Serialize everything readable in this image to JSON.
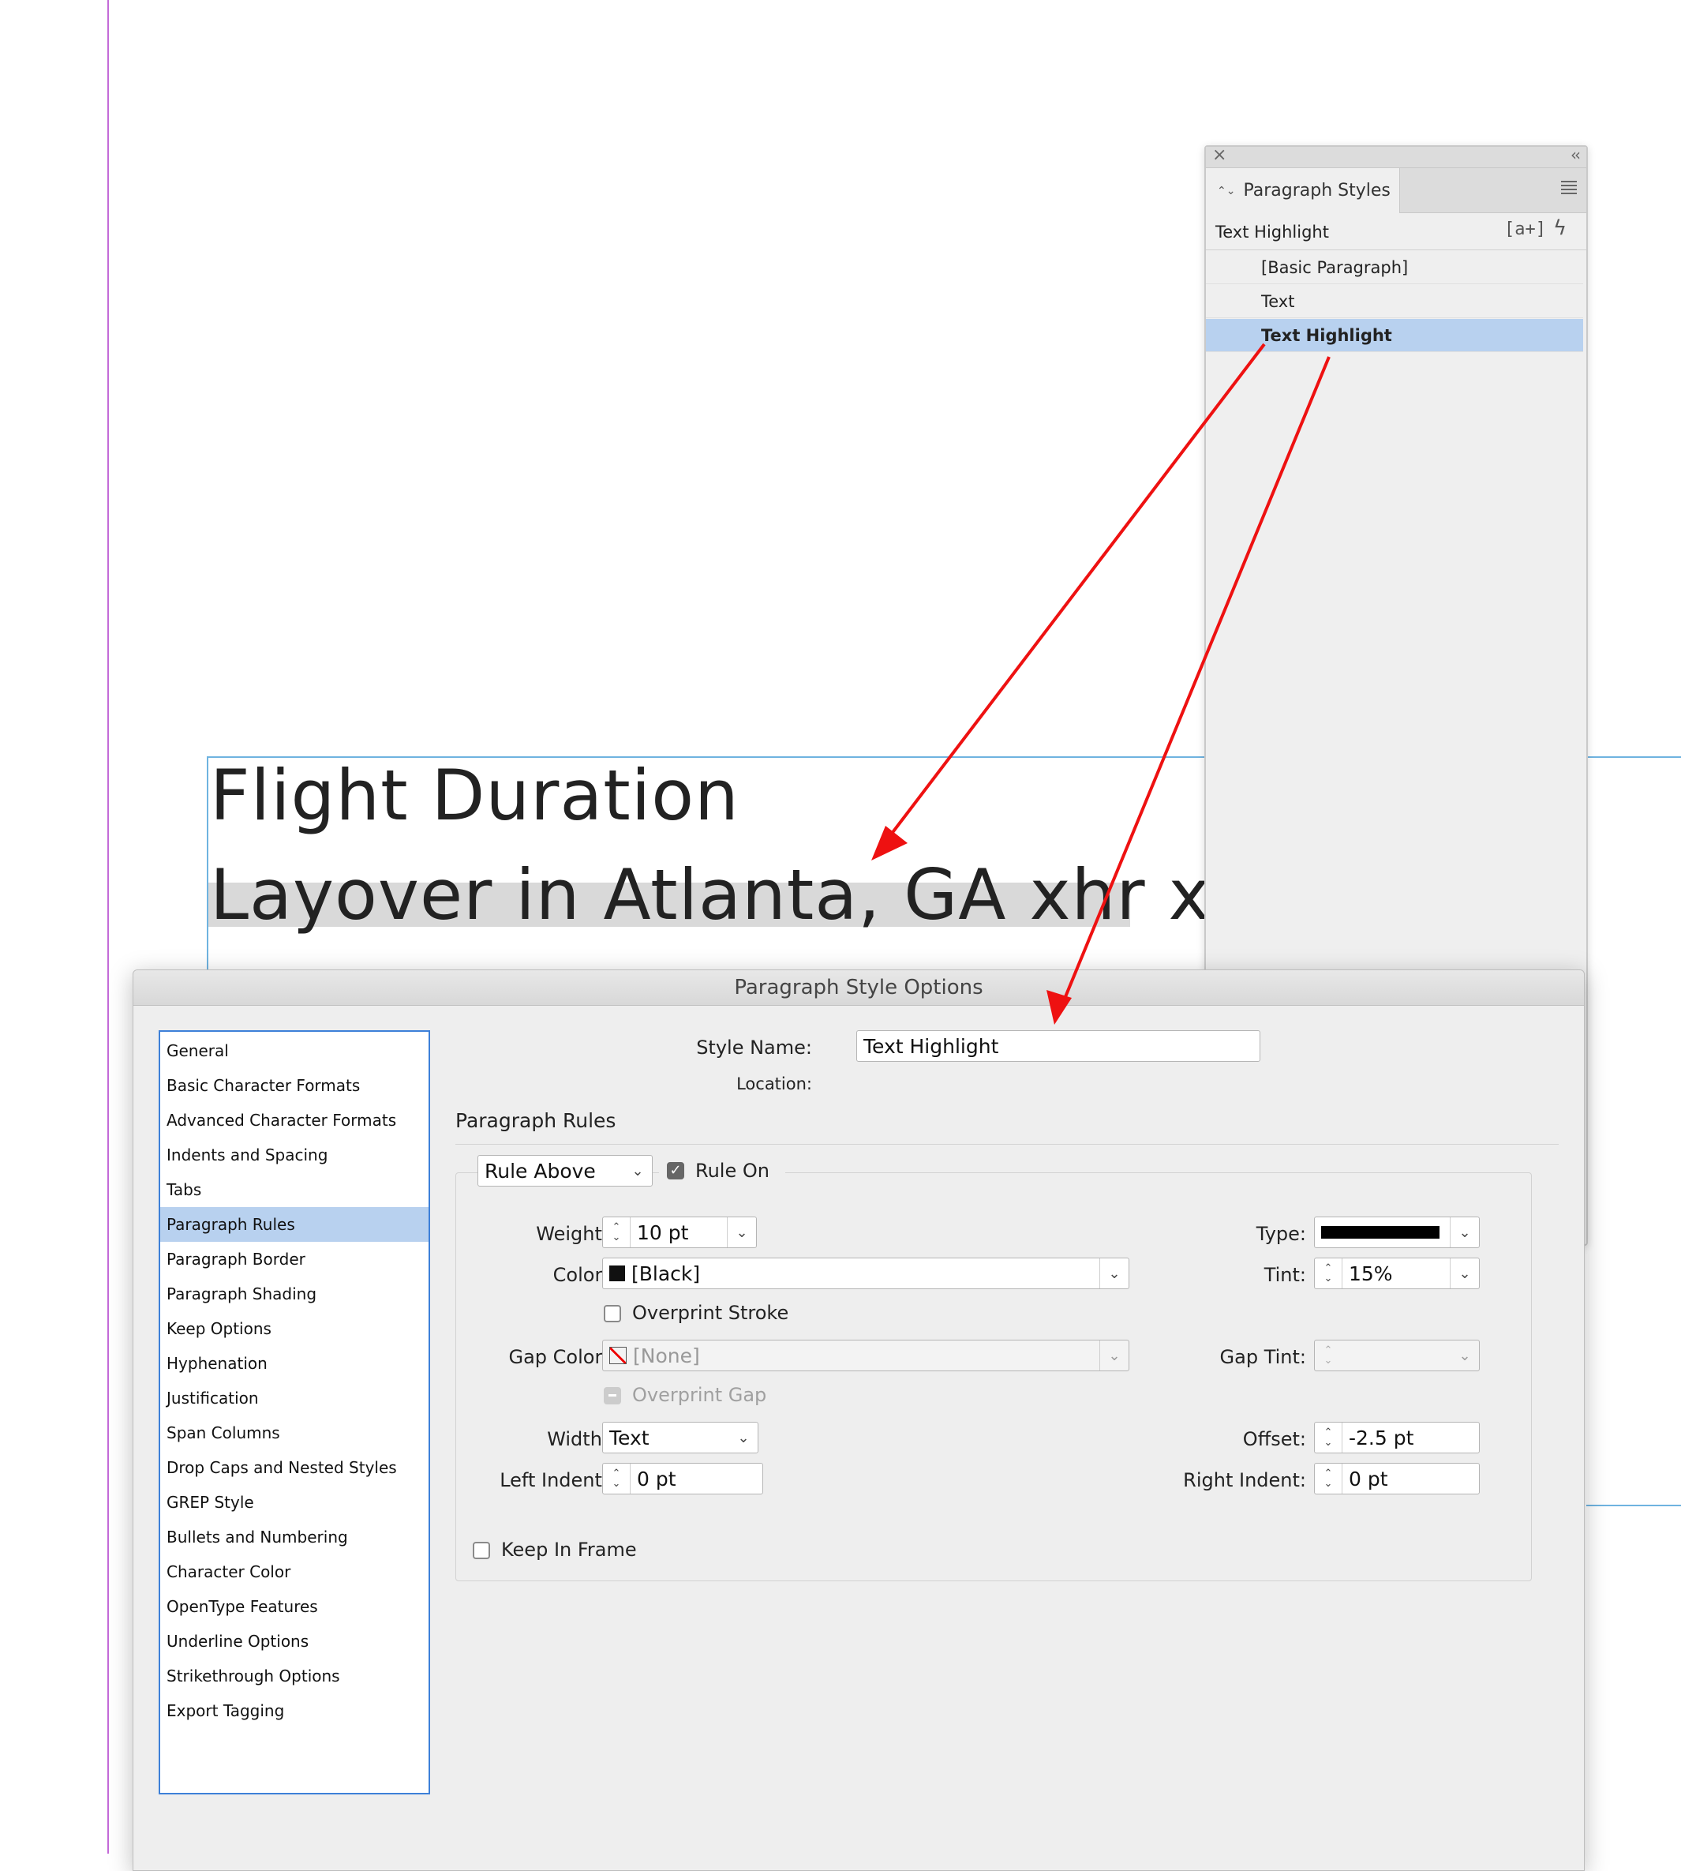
{
  "document": {
    "headline_1": "Flight Duration",
    "headline_2": "Layover in Atlanta, GA xhr xm"
  },
  "styles_panel": {
    "close_glyph": "×",
    "collapse_glyph": "‹‹",
    "tab_label": "Paragraph Styles",
    "current_style": "Text Highlight",
    "new_style_glyph": "[a+]",
    "quick_apply_glyph": "ϟ",
    "items": [
      {
        "label": "[Basic Paragraph]"
      },
      {
        "label": "Text"
      },
      {
        "label": "Text Highlight"
      }
    ],
    "selected_index": 2
  },
  "dialog": {
    "title": "Paragraph Style Options",
    "categories": [
      "General",
      "Basic Character Formats",
      "Advanced Character Formats",
      "Indents and Spacing",
      "Tabs",
      "Paragraph Rules",
      "Paragraph Border",
      "Paragraph Shading",
      "Keep Options",
      "Hyphenation",
      "Justification",
      "Span Columns",
      "Drop Caps and Nested Styles",
      "GREP Style",
      "Bullets and Numbering",
      "Character Color",
      "OpenType Features",
      "Underline Options",
      "Strikethrough Options",
      "Export Tagging"
    ],
    "selected_category": "Paragraph Rules",
    "style_name_label": "Style Name:",
    "style_name_value": "Text Highlight",
    "location_label": "Location:",
    "section_title": "Paragraph Rules",
    "rule_select": "Rule Above",
    "rule_on_label": "Rule On",
    "rule_on": true,
    "weight_label": "Weight:",
    "weight_value": "10 pt",
    "type_label": "Type:",
    "color_label": "Color:",
    "color_value": "[Black]",
    "tint_label": "Tint:",
    "tint_value": "15%",
    "overprint_stroke_label": "Overprint Stroke",
    "overprint_stroke": false,
    "gap_color_label": "Gap Color:",
    "gap_color_value": "[None]",
    "gap_tint_label": "Gap Tint:",
    "gap_tint_value": "",
    "overprint_gap_label": "Overprint Gap",
    "width_label": "Width:",
    "width_value": "Text",
    "offset_label": "Offset:",
    "offset_value": "-2.5 pt",
    "left_indent_label": "Left Indent:",
    "left_indent_value": "0 pt",
    "right_indent_label": "Right Indent:",
    "right_indent_value": "0 pt",
    "keep_in_frame_label": "Keep In Frame",
    "keep_in_frame": false
  },
  "colors": {
    "selection": "#b8d1ef",
    "annotation_arrow": "#ee1111",
    "margin_guide": "#c46bd8",
    "frame_edge": "#6fb3e0"
  }
}
